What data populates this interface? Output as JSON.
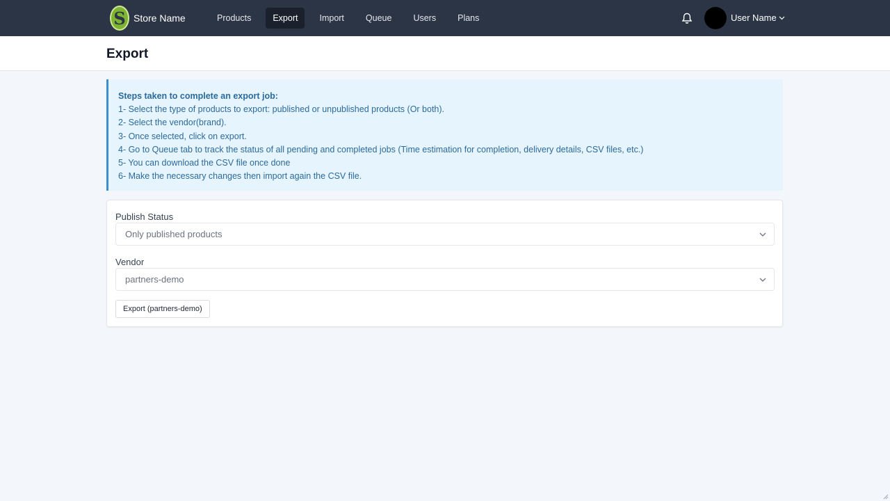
{
  "app": {
    "store_name": "Store Name",
    "logo_letter": "S",
    "colors": {
      "nav_bg": "#2c3545",
      "accent": "#7fb432",
      "info_text": "#2b6a9c"
    }
  },
  "nav": {
    "items": [
      {
        "label": "Products",
        "active": false
      },
      {
        "label": "Export",
        "active": true
      },
      {
        "label": "Import",
        "active": false
      },
      {
        "label": "Queue",
        "active": false
      },
      {
        "label": "Users",
        "active": false
      },
      {
        "label": "Plans",
        "active": false
      }
    ]
  },
  "user": {
    "name": "User Name",
    "bell_icon": "bell-icon",
    "dropdown_icon": "chevron-down-icon"
  },
  "page": {
    "title": "Export"
  },
  "info": {
    "title": "Steps taken to complete an export job:",
    "steps": [
      "1- Select the type of products to export: published or unpublished products (Or both).",
      "2- Select the vendor(brand).",
      "3- Once selected, click on export.",
      "4- Go to Queue tab to track the status of all pending and completed jobs (Time estimation for completion, delivery details, CSV files, etc.)",
      "5- You can download the CSV file once done",
      "6- Make the necessary changes then import again the CSV file."
    ]
  },
  "form": {
    "publish_status": {
      "label": "Publish Status",
      "value": "Only published products"
    },
    "vendor": {
      "label": "Vendor",
      "value": "partners-demo"
    },
    "export_button": "Export (partners-demo)"
  }
}
